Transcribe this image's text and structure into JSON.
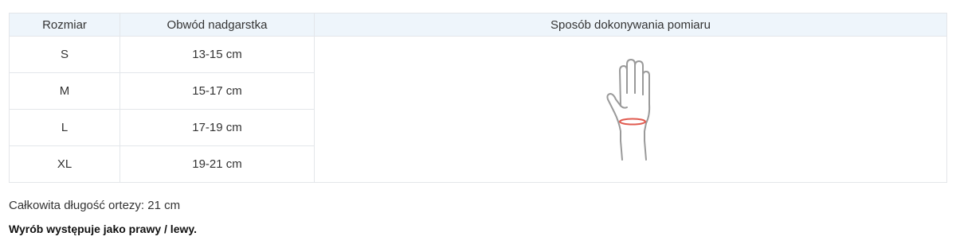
{
  "table": {
    "headers": [
      "Rozmiar",
      "Obwód nadgarstka",
      "Sposób dokonywania pomiaru"
    ],
    "rows": [
      {
        "size": "S",
        "range": "13-15 cm"
      },
      {
        "size": "M",
        "range": "15-17 cm"
      },
      {
        "size": "L",
        "range": "17-19 cm"
      },
      {
        "size": "XL",
        "range": "19-21 cm"
      }
    ]
  },
  "notes": {
    "length": "Całkowita długość ortezy: 21 cm",
    "side": "Wyrób występuje jako prawy / lewy."
  },
  "illustration": {
    "icon": "hand-wrist-measurement-icon",
    "outline_color": "#9a9a9a",
    "measure_color": "#e05a4f"
  }
}
